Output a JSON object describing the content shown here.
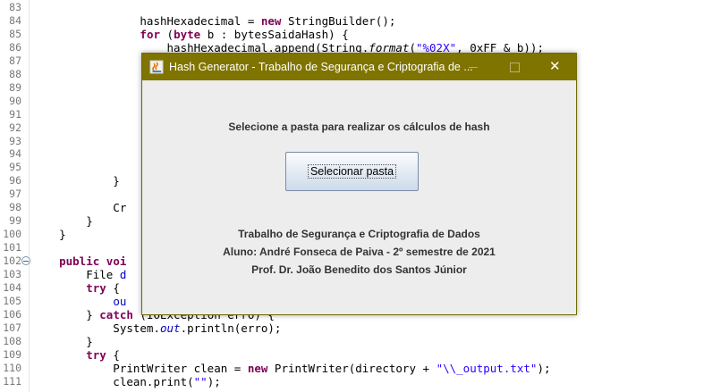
{
  "editor": {
    "lines": [
      {
        "n": "83",
        "parts": []
      },
      {
        "n": "84",
        "parts": [
          {
            "t": "                hashHexadecimal = ",
            "c": ""
          },
          {
            "t": "new",
            "c": "kw"
          },
          {
            "t": " StringBuilder();",
            "c": ""
          }
        ]
      },
      {
        "n": "85",
        "parts": [
          {
            "t": "                ",
            "c": ""
          },
          {
            "t": "for",
            "c": "kw"
          },
          {
            "t": " (",
            "c": ""
          },
          {
            "t": "byte",
            "c": "kw"
          },
          {
            "t": " b : bytesSaidaHash) {",
            "c": ""
          }
        ]
      },
      {
        "n": "86",
        "parts": [
          {
            "t": "                    hashHexadecimal.append(String.",
            "c": ""
          },
          {
            "t": "format",
            "c": "it"
          },
          {
            "t": "(",
            "c": ""
          },
          {
            "t": "\"%02X\"",
            "c": "str"
          },
          {
            "t": ", 0xFF & b));",
            "c": ""
          }
        ]
      },
      {
        "n": "87",
        "parts": []
      },
      {
        "n": "88",
        "parts": []
      },
      {
        "n": "89",
        "parts": []
      },
      {
        "n": "90",
        "parts": []
      },
      {
        "n": "91",
        "parts": []
      },
      {
        "n": "92",
        "parts": []
      },
      {
        "n": "93",
        "parts": []
      },
      {
        "n": "94",
        "parts": []
      },
      {
        "n": "95",
        "parts": []
      },
      {
        "n": "96",
        "parts": [
          {
            "t": "            }",
            "c": ""
          }
        ]
      },
      {
        "n": "97",
        "parts": []
      },
      {
        "n": "98",
        "parts": [
          {
            "t": "            Cr",
            "c": ""
          }
        ]
      },
      {
        "n": "99",
        "parts": [
          {
            "t": "        }",
            "c": ""
          }
        ]
      },
      {
        "n": "100",
        "parts": [
          {
            "t": "    }",
            "c": ""
          }
        ]
      },
      {
        "n": "101",
        "parts": []
      },
      {
        "n": "102",
        "parts": [
          {
            "t": "    ",
            "c": ""
          },
          {
            "t": "public",
            "c": "kw"
          },
          {
            "t": " voi",
            "c": "kw"
          }
        ]
      },
      {
        "n": "103",
        "parts": [
          {
            "t": "        File ",
            "c": ""
          },
          {
            "t": "d",
            "c": "fld"
          }
        ]
      },
      {
        "n": "104",
        "parts": [
          {
            "t": "        ",
            "c": ""
          },
          {
            "t": "try",
            "c": "kw"
          },
          {
            "t": " {",
            "c": ""
          }
        ]
      },
      {
        "n": "105",
        "parts": [
          {
            "t": "            ",
            "c": ""
          },
          {
            "t": "ou",
            "c": "fld"
          }
        ]
      },
      {
        "n": "106",
        "parts": [
          {
            "t": "        } ",
            "c": ""
          },
          {
            "t": "catch",
            "c": "kw"
          },
          {
            "t": " (IOException erro) {",
            "c": ""
          }
        ]
      },
      {
        "n": "107",
        "parts": [
          {
            "t": "            System.",
            "c": ""
          },
          {
            "t": "out",
            "c": "fld it"
          },
          {
            "t": ".println(erro);",
            "c": ""
          }
        ]
      },
      {
        "n": "108",
        "parts": [
          {
            "t": "        }",
            "c": ""
          }
        ]
      },
      {
        "n": "109",
        "parts": [
          {
            "t": "        ",
            "c": ""
          },
          {
            "t": "try",
            "c": "kw"
          },
          {
            "t": " {",
            "c": ""
          }
        ]
      },
      {
        "n": "110",
        "parts": [
          {
            "t": "            PrintWriter clean = ",
            "c": ""
          },
          {
            "t": "new",
            "c": "kw"
          },
          {
            "t": " PrintWriter(directory + ",
            "c": ""
          },
          {
            "t": "\"\\\\_output.txt\"",
            "c": "str"
          },
          {
            "t": ");",
            "c": ""
          }
        ]
      },
      {
        "n": "111",
        "parts": [
          {
            "t": "            clean.print(",
            "c": ""
          },
          {
            "t": "\"\"",
            "c": "str"
          },
          {
            "t": ");",
            "c": ""
          }
        ]
      }
    ]
  },
  "dialog": {
    "title": "Hash Generator - Trabalho de Segurança e Criptografia de ...",
    "close_glyph": "✕",
    "prompt": "Selecione a pasta para realizar os cálculos de hash",
    "select_button": "Selecionar pasta",
    "info_line1": "Trabalho de Segurança e Criptografia de Dados",
    "info_line2": "Aluno: André Fonseca de Paiva - 2º semestre de 2021",
    "info_line3": "Prof. Dr. João Benedito dos Santos Júnior"
  },
  "colors": {
    "titlebar": "#7f7400",
    "keyword": "#7f0055",
    "string": "#2a00ff",
    "field": "#0000c0"
  }
}
